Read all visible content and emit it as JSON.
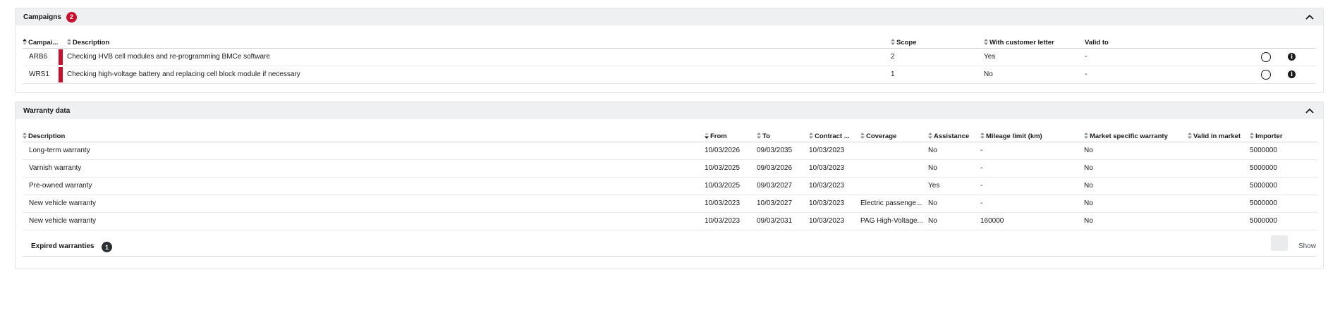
{
  "campaigns": {
    "title": "Campaigns",
    "count": "2",
    "columns": {
      "campaign": "Campai...",
      "description": "Description",
      "scope": "Scope",
      "with_customer_letter": "With customer letter",
      "valid_to": "Valid to"
    },
    "rows": [
      {
        "campaign": "ARB6",
        "description": "Checking HVB cell modules and re-programming BMCe software",
        "scope": "2",
        "with_customer_letter": "Yes",
        "valid_to": "-"
      },
      {
        "campaign": "WRS1",
        "description": "Checking high-voltage battery and replacing cell block module if necessary",
        "scope": "1",
        "with_customer_letter": "No",
        "valid_to": "-"
      }
    ],
    "info_glyph": "i",
    "accent_color": "#c8102e"
  },
  "warranty": {
    "title": "Warranty data",
    "columns": {
      "description": "Description",
      "from": "From",
      "to": "To",
      "contract": "Contract ...",
      "coverage": "Coverage",
      "assistance": "Assistance",
      "mileage_limit": "Mileage limit (km)",
      "market_specific": "Market specific warranty",
      "valid_in_market": "Valid in market",
      "importer": "Importer"
    },
    "rows": [
      {
        "description": "Long-term warranty",
        "from": "10/03/2026",
        "to": "09/03/2035",
        "contract": "10/03/2023",
        "coverage": "",
        "assistance": "No",
        "mileage_limit": "-",
        "market_specific": "No",
        "valid_in_market": "",
        "importer": "5000000"
      },
      {
        "description": "Varnish warranty",
        "from": "10/03/2025",
        "to": "09/03/2026",
        "contract": "10/03/2023",
        "coverage": "",
        "assistance": "No",
        "mileage_limit": "-",
        "market_specific": "No",
        "valid_in_market": "",
        "importer": "5000000"
      },
      {
        "description": "Pre-owned warranty",
        "from": "10/03/2025",
        "to": "09/03/2027",
        "contract": "10/03/2023",
        "coverage": "",
        "assistance": "Yes",
        "mileage_limit": "-",
        "market_specific": "No",
        "valid_in_market": "",
        "importer": "5000000"
      },
      {
        "description": "New vehicle warranty",
        "from": "10/03/2023",
        "to": "10/03/2027",
        "contract": "10/03/2023",
        "coverage": "Electric passenge...",
        "assistance": "No",
        "mileage_limit": "-",
        "market_specific": "No",
        "valid_in_market": "",
        "importer": "5000000"
      },
      {
        "description": "New vehicle warranty",
        "from": "10/03/2023",
        "to": "09/03/2031",
        "contract": "10/03/2023",
        "coverage": "PAG High-Voltage...",
        "assistance": "No",
        "mileage_limit": "160000",
        "market_specific": "No",
        "valid_in_market": "",
        "importer": "5000000"
      }
    ],
    "expired": {
      "label": "Expired warranties",
      "count": "1",
      "show_label": "Show"
    }
  }
}
